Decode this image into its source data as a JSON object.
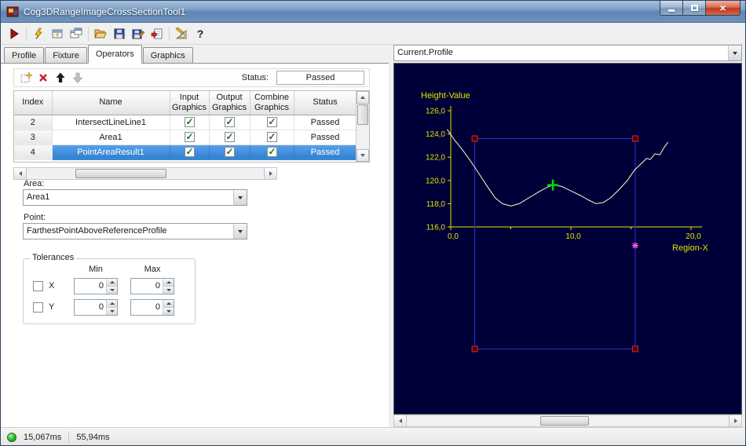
{
  "window": {
    "title": "Cog3DRangeImageCrossSectionTool1"
  },
  "titlebar_icons": [
    "window-icon",
    "minimize-icon",
    "maximize-icon",
    "close-icon"
  ],
  "toolbar": {
    "icons": [
      "run-icon",
      "electric-run-icon",
      "tool-editor-icon",
      "float-window-icon",
      "open-file-icon",
      "save-file-icon",
      "save-as-icon",
      "import-icon",
      "measure-icon",
      "help-icon"
    ]
  },
  "tabs": {
    "items": [
      {
        "label": "Profile",
        "active": false
      },
      {
        "label": "Fixture",
        "active": false
      },
      {
        "label": "Operators",
        "active": true
      },
      {
        "label": "Graphics",
        "active": false
      }
    ]
  },
  "operators": {
    "toolbar_icons": [
      "add-operator-icon",
      "delete-operator-icon",
      "move-up-icon",
      "move-down-icon"
    ],
    "status_label": "Status:",
    "status_value": "Passed",
    "table": {
      "columns": [
        "Index",
        "Name",
        "Input Graphics",
        "Output Graphics",
        "Combine Graphics",
        "Status"
      ],
      "rows": [
        {
          "index": "2",
          "name": "IntersectLineLine1",
          "input_graphics": true,
          "output_graphics": true,
          "combine_graphics": true,
          "status": "Passed",
          "selected": false
        },
        {
          "index": "3",
          "name": "Area1",
          "input_graphics": true,
          "output_graphics": true,
          "combine_graphics": true,
          "status": "Passed",
          "selected": false
        },
        {
          "index": "4",
          "name": "PointAreaResult1",
          "input_graphics": true,
          "output_graphics": true,
          "combine_graphics": true,
          "status": "Passed",
          "selected": true
        }
      ]
    },
    "area": {
      "label": "Area:",
      "value": "Area1"
    },
    "point": {
      "label": "Point:",
      "value": "FarthestPointAboveReferenceProfile"
    },
    "tolerances": {
      "title": "Tolerances",
      "min_header": "Min",
      "max_header": "Max",
      "rows": [
        {
          "label": "X",
          "checked": false,
          "min": "0",
          "max": "0"
        },
        {
          "label": "Y",
          "checked": false,
          "min": "0",
          "max": "0"
        }
      ]
    }
  },
  "right_panel": {
    "profile_selector": "Current.Profile"
  },
  "status_bar": {
    "run_indicator_color": "#1cb41c",
    "execution_time": "15,067ms",
    "result_time": "55,94ms"
  },
  "chart_data": {
    "type": "line",
    "title": "Current.Profile",
    "ylabel": "Height-Value",
    "xlabel": "Region-X",
    "background": "#000038",
    "axis_color": "#e3e300",
    "grid": false,
    "legend": "none",
    "xlim": [
      0,
      20
    ],
    "ylim": [
      116,
      126
    ],
    "x_ticks": [
      {
        "v": 0,
        "label": "0,0"
      },
      {
        "v": 10,
        "label": "10,0"
      },
      {
        "v": 20,
        "label": "20,0"
      }
    ],
    "x_minor_ticks": [
      5,
      15
    ],
    "y_ticks": [
      {
        "v": 126,
        "label": "126,0"
      },
      {
        "v": 124,
        "label": "124,0"
      },
      {
        "v": 122,
        "label": "122,0"
      },
      {
        "v": 120,
        "label": "120,0"
      },
      {
        "v": 118,
        "label": "118,0"
      },
      {
        "v": 116,
        "label": "116,0"
      }
    ],
    "series": [
      {
        "name": "profile-curve",
        "color": "#ffffcc",
        "points": [
          [
            -0.3,
            124.4
          ],
          [
            0.3,
            123.5
          ],
          [
            1.0,
            122.6
          ],
          [
            1.7,
            121.6
          ],
          [
            2.4,
            120.5
          ],
          [
            3.1,
            119.4
          ],
          [
            3.7,
            118.5
          ],
          [
            4.3,
            118.0
          ],
          [
            5.0,
            117.8
          ],
          [
            5.7,
            118.0
          ],
          [
            6.5,
            118.5
          ],
          [
            7.3,
            119.0
          ],
          [
            8.0,
            119.4
          ],
          [
            8.5,
            119.6
          ],
          [
            9.2,
            119.5
          ],
          [
            10.0,
            119.1
          ],
          [
            10.8,
            118.7
          ],
          [
            11.5,
            118.3
          ],
          [
            12.1,
            118.0
          ],
          [
            12.7,
            118.1
          ],
          [
            13.3,
            118.5
          ],
          [
            14.0,
            119.2
          ],
          [
            14.7,
            120.0
          ],
          [
            15.3,
            120.9
          ],
          [
            15.9,
            121.5
          ],
          [
            16.3,
            121.9
          ],
          [
            16.6,
            121.8
          ],
          [
            17.0,
            122.3
          ],
          [
            17.4,
            122.2
          ],
          [
            17.8,
            122.9
          ],
          [
            18.1,
            123.3
          ]
        ]
      }
    ],
    "region_box": {
      "x0": 2.0,
      "x1": 15.35,
      "y0": 105.5,
      "y1": 123.6,
      "color": "#2a35cf",
      "corner_fill": "#4a000a",
      "corner_color": "#dd2525"
    },
    "markers": [
      {
        "type": "cross",
        "name": "result-point-marker",
        "x": 8.5,
        "y": 119.6,
        "color": "#00dd00"
      },
      {
        "type": "asterisk",
        "name": "farthest-point-marker",
        "x": 15.35,
        "y": 114.4,
        "color": "#ff55ff"
      }
    ]
  }
}
